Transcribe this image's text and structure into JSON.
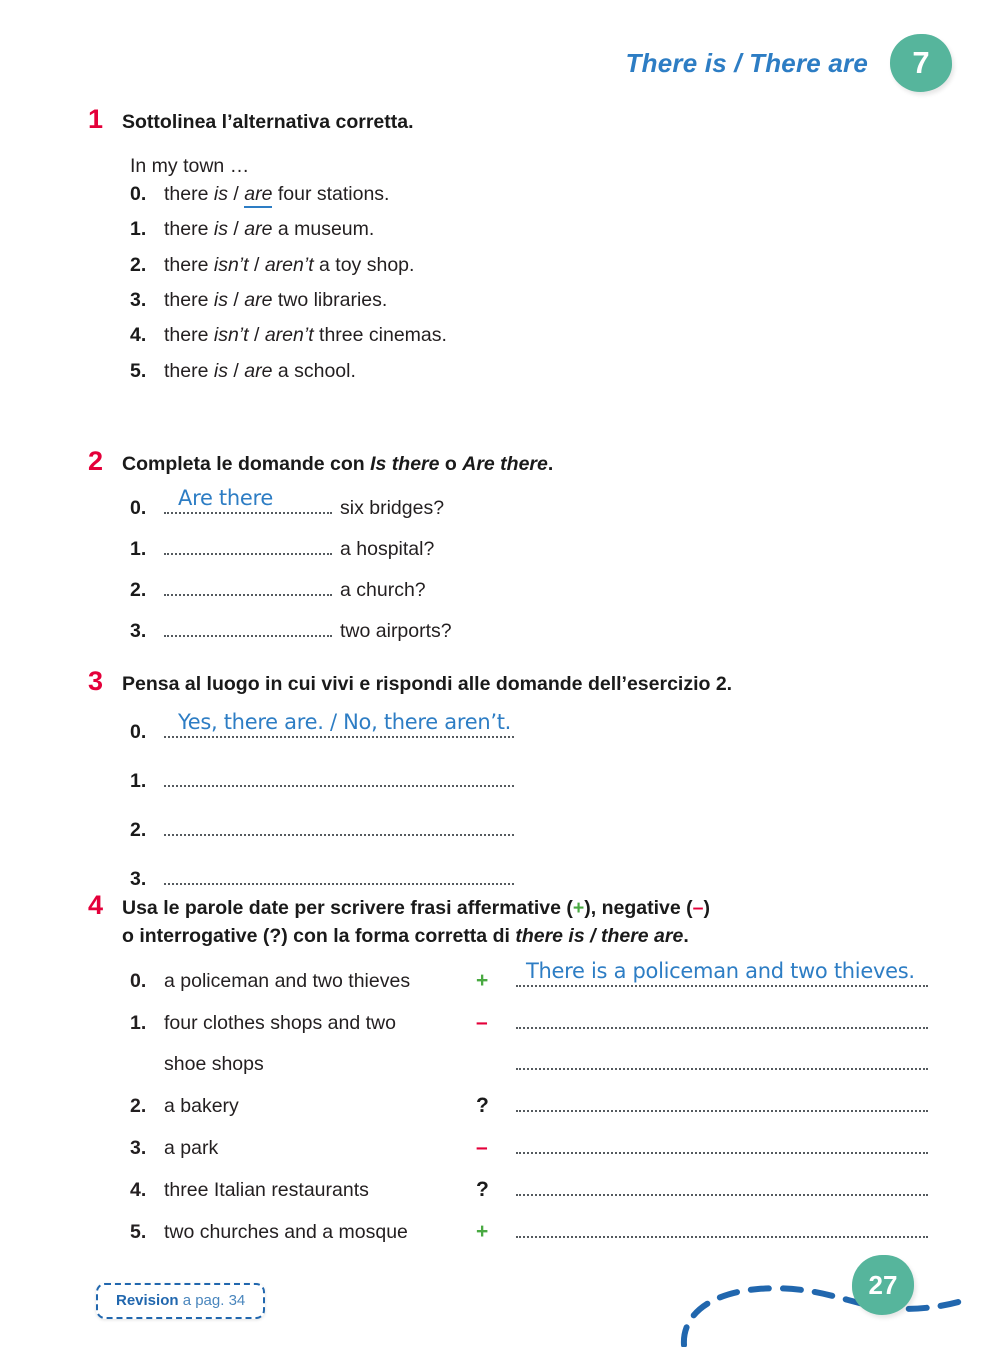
{
  "header": {
    "unit_title": "There is / There are",
    "unit_number": "7",
    "badge_color": "#56b59c",
    "title_color": "#2d7dc4"
  },
  "colors": {
    "exercise_number": "#e4003a",
    "answer_blue": "#2d7dc4",
    "plus_green": "#49a942",
    "minus_red": "#e4003a",
    "dotted_line": "#555a5e"
  },
  "exercises": [
    {
      "number": "1",
      "title": "Sottolinea l’alternativa corretta.",
      "lead_in": "In my town …",
      "items": [
        {
          "num": "0.",
          "pre": "there ",
          "opt_a": "is",
          "sep": " / ",
          "opt_b": "are",
          "post": " four stations.",
          "answer": "are"
        },
        {
          "num": "1.",
          "pre": "there ",
          "opt_a": "is",
          "sep": " / ",
          "opt_b": "are",
          "post": " a museum.",
          "answer": ""
        },
        {
          "num": "2.",
          "pre": "there ",
          "opt_a": "isn’t",
          "sep": " / ",
          "opt_b": "aren’t",
          "post": " a toy shop.",
          "answer": ""
        },
        {
          "num": "3.",
          "pre": "there ",
          "opt_a": "is",
          "sep": " / ",
          "opt_b": "are",
          "post": " two libraries.",
          "answer": ""
        },
        {
          "num": "4.",
          "pre": "there ",
          "opt_a": "isn’t",
          "sep": " / ",
          "opt_b": "aren’t",
          "post": " three cinemas.",
          "answer": ""
        },
        {
          "num": "5.",
          "pre": "there ",
          "opt_a": "is",
          "sep": " / ",
          "opt_b": "are",
          "post": " a school.",
          "answer": ""
        }
      ]
    },
    {
      "number": "2",
      "title_part1": "Completa le domande con ",
      "title_em1": "Is there",
      "title_part2": " o ",
      "title_em2": "Are there",
      "title_part3": ".",
      "items": [
        {
          "num": "0.",
          "filled": "Are there",
          "tail": " six bridges?"
        },
        {
          "num": "1.",
          "filled": "",
          "tail": " a hospital?"
        },
        {
          "num": "2.",
          "filled": "",
          "tail": " a church?"
        },
        {
          "num": "3.",
          "filled": "",
          "tail": " two airports?"
        }
      ]
    },
    {
      "number": "3",
      "title": "Pensa al luogo in cui vivi e rispondi alle domande dell’esercizio 2.",
      "items": [
        {
          "num": "0.",
          "filled": "Yes, there are. / No, there aren’t."
        },
        {
          "num": "1.",
          "filled": ""
        },
        {
          "num": "2.",
          "filled": ""
        },
        {
          "num": "3.",
          "filled": ""
        }
      ]
    },
    {
      "number": "4",
      "title_part1": "Usa le parole date per scrivere frasi affermative (",
      "title_plus": "+",
      "title_part2": "), negative (",
      "title_minus": "–",
      "title_part3": ")",
      "title_line2_part1": "o interrogative (?) con la forma corretta di ",
      "title_line2_em": "there is / there are",
      "title_line2_part2": ".",
      "items": [
        {
          "num": "0.",
          "words": "a policeman and two thieves",
          "words_line2": "",
          "sign": "+",
          "sign_type": "plus",
          "filled": "There is a policeman and two thieves."
        },
        {
          "num": "1.",
          "words": "four clothes shops and two",
          "words_line2": "shoe shops",
          "sign": "–",
          "sign_type": "minus",
          "filled": ""
        },
        {
          "num": "2.",
          "words": "a bakery",
          "words_line2": "",
          "sign": "?",
          "sign_type": "question",
          "filled": ""
        },
        {
          "num": "3.",
          "words": "a park",
          "words_line2": "",
          "sign": "–",
          "sign_type": "minus",
          "filled": ""
        },
        {
          "num": "4.",
          "words": "three Italian restaurants",
          "words_line2": "",
          "sign": "?",
          "sign_type": "question",
          "filled": ""
        },
        {
          "num": "5.",
          "words": "two churches and a mosque",
          "words_line2": "",
          "sign": "+",
          "sign_type": "plus",
          "filled": ""
        }
      ]
    }
  ],
  "footer": {
    "revision_label": "Revision",
    "revision_ref": " a pag. 34",
    "page_number": "27"
  }
}
